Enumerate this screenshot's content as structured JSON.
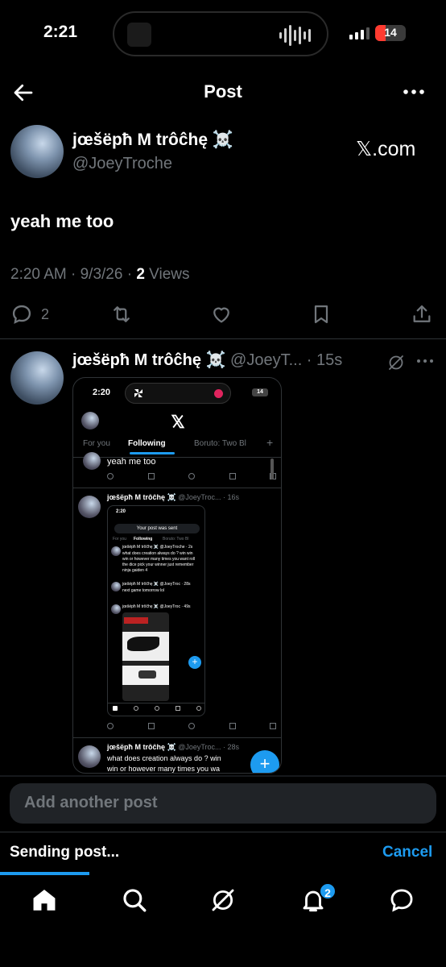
{
  "status_bar": {
    "time": "2:21",
    "battery": "14"
  },
  "header": {
    "title": "Post"
  },
  "post": {
    "author_name": "jœšëpħ M trôĉhę ☠️",
    "author_handle": "@JoeyTroche",
    "source_badge": "𝕏.com",
    "text": "yeah me too",
    "timestamp": "2:20 AM · 9/3/26 · ",
    "views_count": "2",
    "views_label": " Views",
    "reply_count": "2"
  },
  "reply": {
    "author_name": "jœšëpħ M trôĉhę ☠️",
    "author_handle": "@JoeyT...",
    "separator": " · ",
    "age": "15s"
  },
  "media": {
    "time": "2:20",
    "battery": "14",
    "tabs": [
      "For you",
      "Following",
      "Boruto: Two Bl"
    ],
    "quoted_text": "yeah me too",
    "row1_name": "jœšëpħ M trôĉhę ☠️",
    "row1_meta": "@JoeyTroc... · 16s",
    "inner_time": "2:20",
    "inner_toast": "Your post was sent",
    "inner_tabs": [
      "For you",
      "Following",
      "Boruto: Two Bl"
    ],
    "inner_post1_meta": "jœšëpħ M trôĉhę ☠️ @JoeyTroche · 2s",
    "inner_post1_text": [
      "what does creation always do ? win win",
      "win or however many times you want roll",
      "the dice pick your winner just remember",
      "ninja gaiden 4"
    ],
    "inner_post2_meta": "jœšëpħ M trôĉhę ☠️ @JoeyTroc · 28s",
    "inner_post2_text": "next game tomorrow lol",
    "inner_post3_meta": "jœšëpħ M trôĉhę ☠️ @JoeyTroc · 49s",
    "row2_name": "jœšëpħ M trôĉhę ☠️",
    "row2_meta": "@JoeyTroc... · 28s",
    "row2_text_1": "what does creation always do ? win",
    "row2_text_2": "win or however many times you wa"
  },
  "composer": {
    "placeholder": "Add another post"
  },
  "sending": {
    "label": "Sending post...",
    "cancel": "Cancel",
    "progress": 0.2
  },
  "tabbar": {
    "notifications_badge": "2"
  },
  "colors": {
    "accent": "#1d9bf0",
    "muted": "#71767b",
    "background": "#000000"
  }
}
